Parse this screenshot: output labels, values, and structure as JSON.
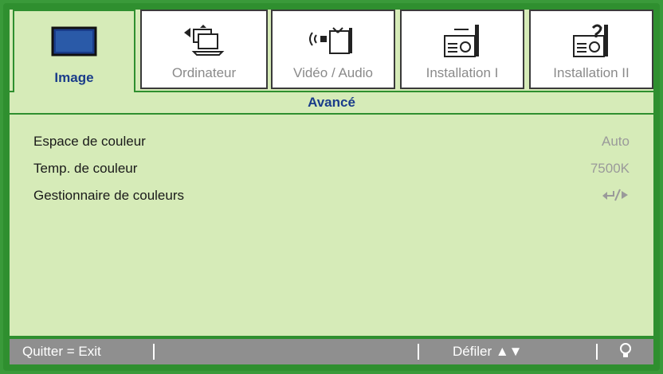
{
  "tabs": [
    {
      "label": "Image",
      "icon": "monitor-icon",
      "active": true
    },
    {
      "label": "Ordinateur",
      "icon": "computer-icon",
      "active": false
    },
    {
      "label": "Vidéo / Audio",
      "icon": "video-audio-icon",
      "active": false
    },
    {
      "label": "Installation I",
      "icon": "projector-icon",
      "active": false
    },
    {
      "label": "Installation II",
      "icon": "projector-2-icon",
      "active": false
    }
  ],
  "submenu": {
    "title": "Avancé"
  },
  "settings": [
    {
      "name": "Espace de couleur",
      "value": "Auto"
    },
    {
      "name": "Temp. de couleur",
      "value": "7500K"
    },
    {
      "name": "Gestionnaire de couleurs",
      "value": "enter-arrow-icon"
    }
  ],
  "footer": {
    "exit": "Quitter = Exit",
    "scroll": "Défiler ▲▼",
    "help_icon": "lightbulb-icon"
  },
  "colors": {
    "frame": "#2f8f2f",
    "panel": "#d6ebb8",
    "active_label": "#1a3c8a",
    "footer": "#8f8f8f"
  }
}
